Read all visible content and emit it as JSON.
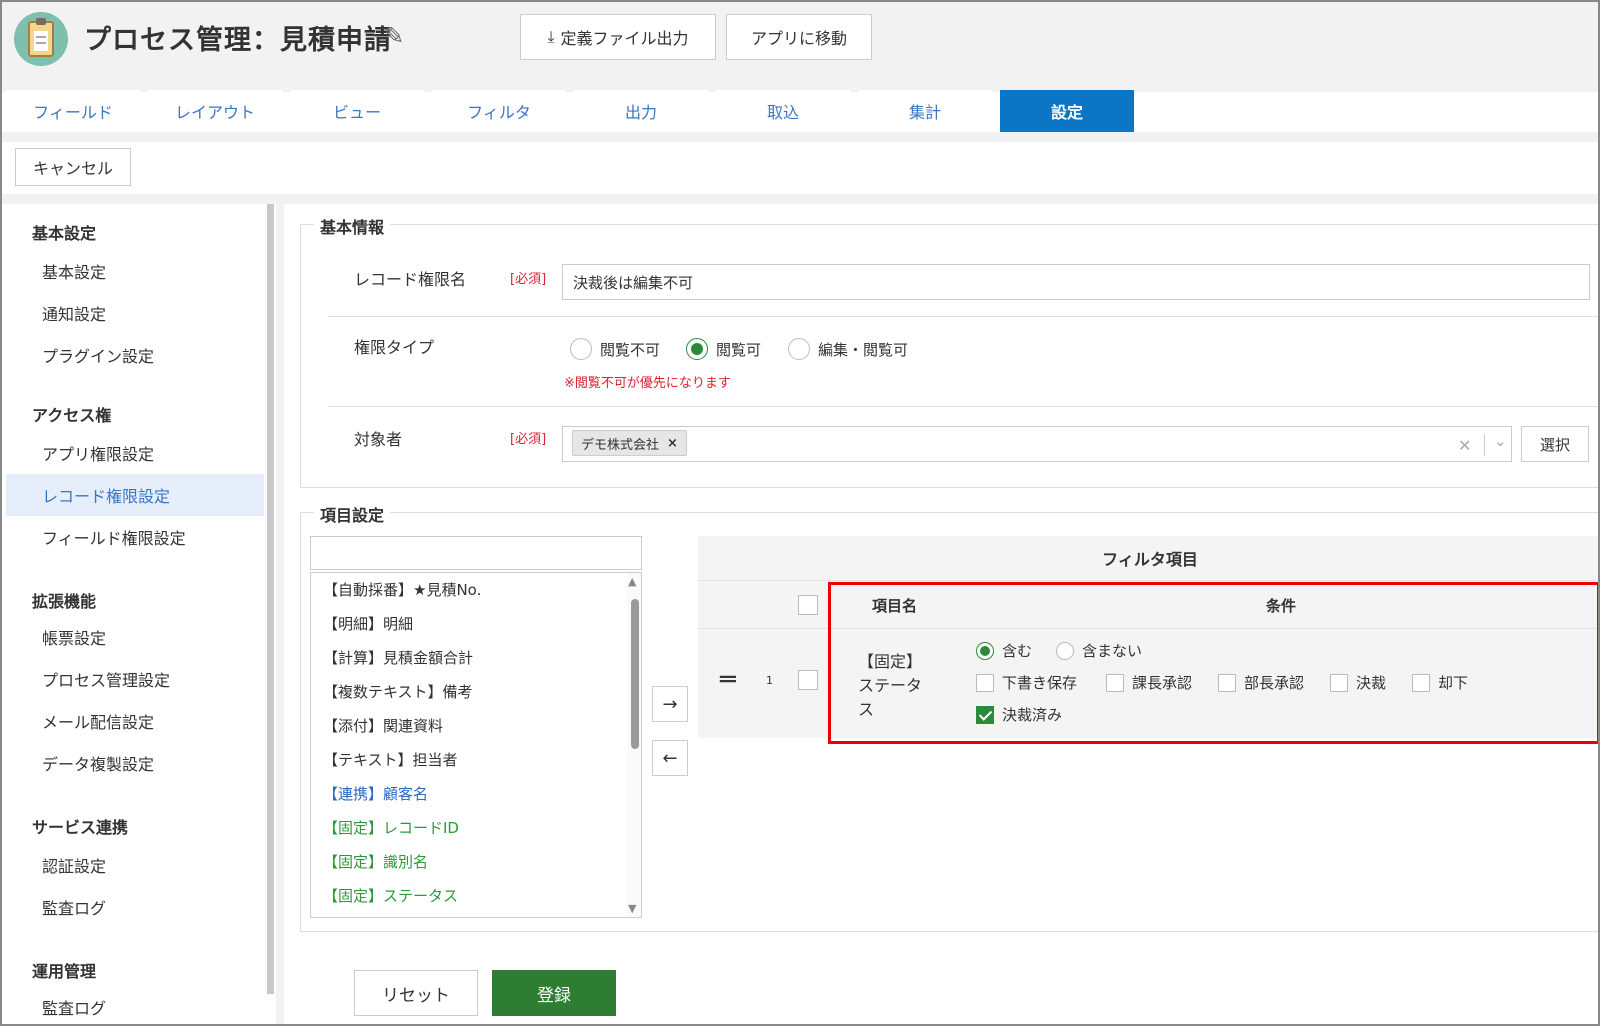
{
  "header": {
    "title": "プロセス管理：見積申請",
    "export_button": "定義ファイル出力",
    "goto_app_button": "アプリに移動"
  },
  "tabs": [
    "フィールド",
    "レイアウト",
    "ビュー",
    "フィルタ",
    "出力",
    "取込",
    "集計",
    "設定"
  ],
  "active_tab": "設定",
  "actions": {
    "cancel": "キャンセル"
  },
  "sidebar": {
    "sections": [
      {
        "title": "基本設定",
        "items": [
          "基本設定",
          "通知設定",
          "プラグイン設定"
        ]
      },
      {
        "title": "アクセス権",
        "items": [
          "アプリ権限設定",
          "レコード権限設定",
          "フィールド権限設定"
        ]
      },
      {
        "title": "拡張機能",
        "items": [
          "帳票設定",
          "プロセス管理設定",
          "メール配信設定",
          "データ複製設定"
        ]
      },
      {
        "title": "サービス連携",
        "items": [
          "認証設定",
          "監査ログ"
        ]
      },
      {
        "title": "運用管理",
        "items": [
          "監査ログ"
        ]
      }
    ],
    "active_item": "レコード権限設定"
  },
  "basic_info": {
    "legend": "基本情報",
    "record_permission_name_label": "レコード権限名",
    "required": "[必須]",
    "record_permission_name_value": "決裁後は編集不可",
    "permission_type_label": "権限タイプ",
    "permission_types": [
      "閲覧不可",
      "閲覧可",
      "編集・閲覧可"
    ],
    "permission_type_selected": "閲覧可",
    "permission_note": "※閲覧不可が優先になります",
    "target_label": "対象者",
    "target_chip": "デモ株式会社",
    "select_button": "選択"
  },
  "item_settings": {
    "legend": "項目設定",
    "list_items": [
      {
        "text": "【自動採番】★見積No.",
        "color": "default"
      },
      {
        "text": "【明細】明細",
        "color": "default"
      },
      {
        "text": "【計算】見積金額合計",
        "color": "default"
      },
      {
        "text": "【複数テキスト】備考",
        "color": "default"
      },
      {
        "text": "【添付】関連資料",
        "color": "default"
      },
      {
        "text": "【テキスト】担当者",
        "color": "default"
      },
      {
        "text": "【連携】顧客名",
        "color": "blue"
      },
      {
        "text": "【固定】レコードID",
        "color": "green"
      },
      {
        "text": "【固定】識別名",
        "color": "green"
      },
      {
        "text": "【固定】ステータス",
        "color": "green"
      }
    ],
    "filter_header": "フィルタ項目",
    "col_item_name": "項目名",
    "col_condition": "条件",
    "row": {
      "number": "1",
      "item_name_line1": "【固定】",
      "item_name_line2": "ステータ",
      "item_name_line3": "ス",
      "match_options": [
        "含む",
        "含まない"
      ],
      "match_selected": "含む",
      "statuses": [
        {
          "label": "下書き保存",
          "checked": false
        },
        {
          "label": "課長承認",
          "checked": false
        },
        {
          "label": "部長承認",
          "checked": false
        },
        {
          "label": "決裁",
          "checked": false
        },
        {
          "label": "却下",
          "checked": false
        },
        {
          "label": "決裁済み",
          "checked": true
        }
      ]
    }
  },
  "footer": {
    "reset": "リセット",
    "register": "登録"
  },
  "colors": {
    "accent_blue": "#0a76c5",
    "register_green": "#2e7d32",
    "highlight_red": "#e00000"
  }
}
